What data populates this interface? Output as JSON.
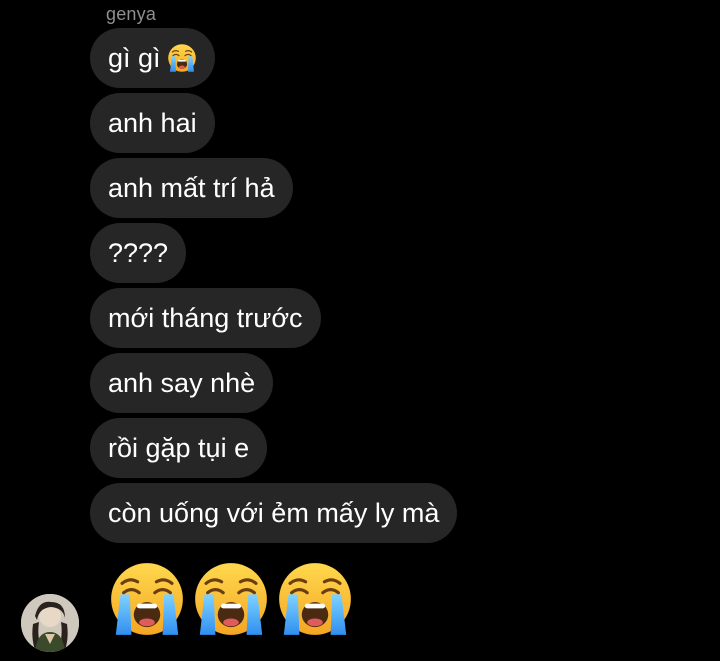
{
  "thread": {
    "sender_name": "genya",
    "messages": [
      {
        "text": "gì gì",
        "emoji": "loudly-crying-face-emoji"
      },
      {
        "text": "anh hai"
      },
      {
        "text": "anh mất trí hả"
      },
      {
        "text": "????"
      },
      {
        "text": "mới tháng trước"
      },
      {
        "text": "anh say nhè"
      },
      {
        "text": "rồi gặp tụi e"
      },
      {
        "text": "còn uống với ẻm mấy ly mà"
      }
    ],
    "emoji_message": [
      "loudly-crying-face-emoji",
      "loudly-crying-face-emoji",
      "loudly-crying-face-emoji"
    ]
  },
  "colors": {
    "background": "#000000",
    "bubble": "#262626",
    "text": "#ffffff",
    "sender_name": "#8e8e93"
  }
}
